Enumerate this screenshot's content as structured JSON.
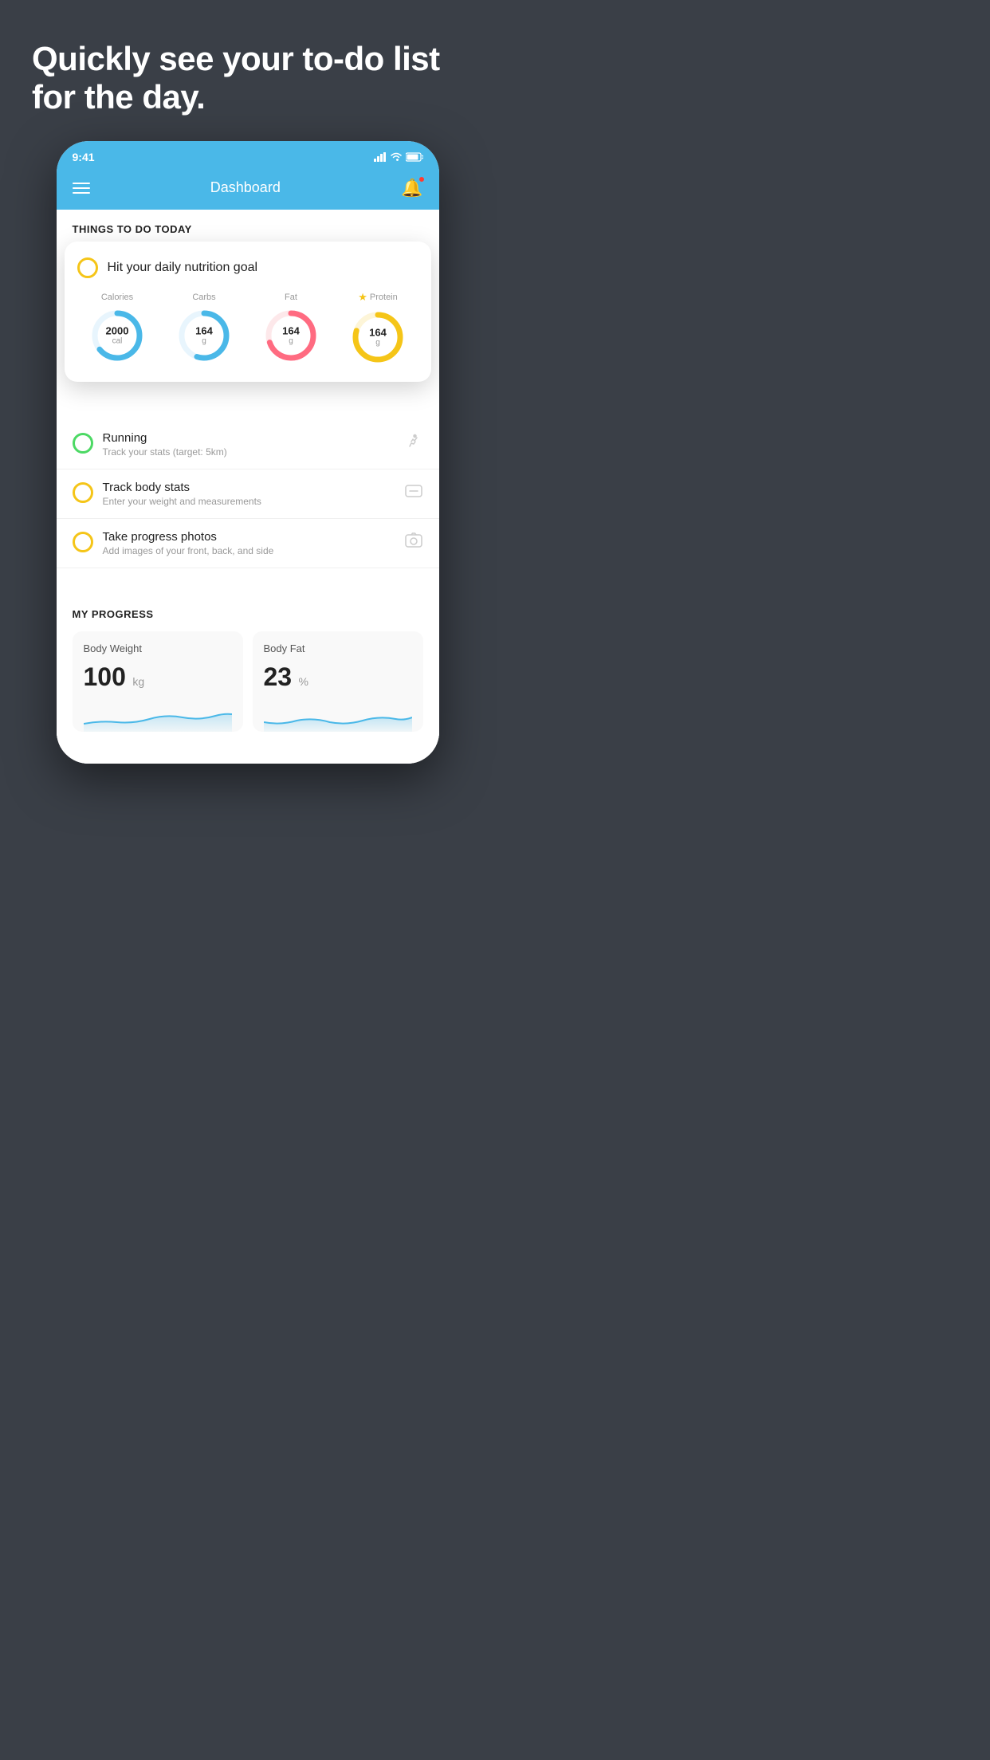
{
  "hero": {
    "title": "Quickly see your to-do list for the day."
  },
  "phone": {
    "status_bar": {
      "time": "9:41",
      "signal": "▲",
      "wifi": "wifi",
      "battery": "battery"
    },
    "nav": {
      "title": "Dashboard"
    },
    "things_section": {
      "title": "THINGS TO DO TODAY"
    },
    "nutrition_card": {
      "title": "Hit your daily nutrition goal",
      "stats": [
        {
          "label": "Calories",
          "value": "2000",
          "unit": "cal",
          "color": "#4ab8e8",
          "pct": 65
        },
        {
          "label": "Carbs",
          "value": "164",
          "unit": "g",
          "color": "#4ab8e8",
          "pct": 55
        },
        {
          "label": "Fat",
          "value": "164",
          "unit": "g",
          "color": "#ff6b81",
          "pct": 70
        },
        {
          "label": "Protein",
          "value": "164",
          "unit": "g",
          "color": "#f5c518",
          "pct": 80,
          "starred": true
        }
      ]
    },
    "todo_items": [
      {
        "title": "Running",
        "subtitle": "Track your stats (target: 5km)",
        "circle_color": "green",
        "icon": "👟"
      },
      {
        "title": "Track body stats",
        "subtitle": "Enter your weight and measurements",
        "circle_color": "yellow",
        "icon": "⚖️"
      },
      {
        "title": "Take progress photos",
        "subtitle": "Add images of your front, back, and side",
        "circle_color": "yellow",
        "icon": "🖼️"
      }
    ],
    "progress_section": {
      "title": "MY PROGRESS",
      "cards": [
        {
          "title": "Body Weight",
          "value": "100",
          "unit": "kg"
        },
        {
          "title": "Body Fat",
          "value": "23",
          "unit": "%"
        }
      ]
    }
  }
}
